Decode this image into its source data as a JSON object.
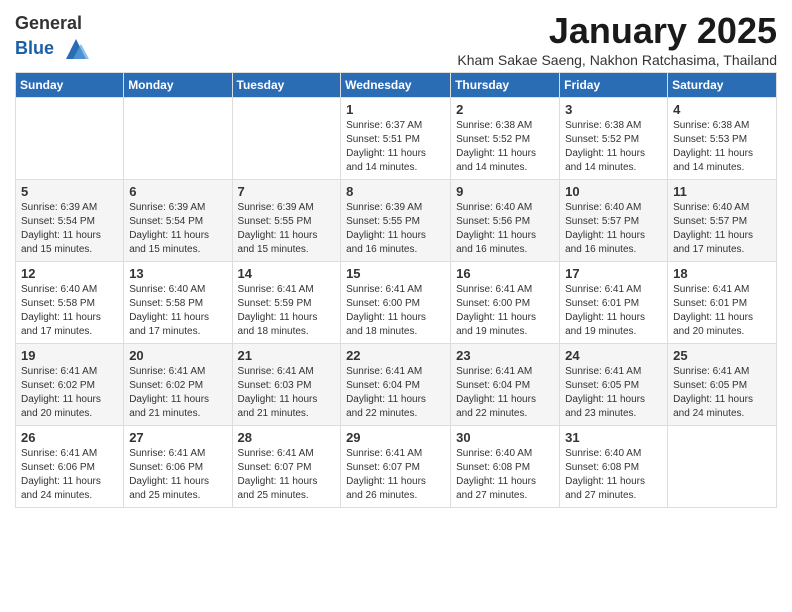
{
  "header": {
    "logo_line1": "General",
    "logo_line2": "Blue",
    "month": "January 2025",
    "location": "Kham Sakae Saeng, Nakhon Ratchasima, Thailand"
  },
  "weekdays": [
    "Sunday",
    "Monday",
    "Tuesday",
    "Wednesday",
    "Thursday",
    "Friday",
    "Saturday"
  ],
  "weeks": [
    [
      {
        "day": "",
        "info": ""
      },
      {
        "day": "",
        "info": ""
      },
      {
        "day": "",
        "info": ""
      },
      {
        "day": "1",
        "info": "Sunrise: 6:37 AM\nSunset: 5:51 PM\nDaylight: 11 hours and 14 minutes."
      },
      {
        "day": "2",
        "info": "Sunrise: 6:38 AM\nSunset: 5:52 PM\nDaylight: 11 hours and 14 minutes."
      },
      {
        "day": "3",
        "info": "Sunrise: 6:38 AM\nSunset: 5:52 PM\nDaylight: 11 hours and 14 minutes."
      },
      {
        "day": "4",
        "info": "Sunrise: 6:38 AM\nSunset: 5:53 PM\nDaylight: 11 hours and 14 minutes."
      }
    ],
    [
      {
        "day": "5",
        "info": "Sunrise: 6:39 AM\nSunset: 5:54 PM\nDaylight: 11 hours and 15 minutes."
      },
      {
        "day": "6",
        "info": "Sunrise: 6:39 AM\nSunset: 5:54 PM\nDaylight: 11 hours and 15 minutes."
      },
      {
        "day": "7",
        "info": "Sunrise: 6:39 AM\nSunset: 5:55 PM\nDaylight: 11 hours and 15 minutes."
      },
      {
        "day": "8",
        "info": "Sunrise: 6:39 AM\nSunset: 5:55 PM\nDaylight: 11 hours and 16 minutes."
      },
      {
        "day": "9",
        "info": "Sunrise: 6:40 AM\nSunset: 5:56 PM\nDaylight: 11 hours and 16 minutes."
      },
      {
        "day": "10",
        "info": "Sunrise: 6:40 AM\nSunset: 5:57 PM\nDaylight: 11 hours and 16 minutes."
      },
      {
        "day": "11",
        "info": "Sunrise: 6:40 AM\nSunset: 5:57 PM\nDaylight: 11 hours and 17 minutes."
      }
    ],
    [
      {
        "day": "12",
        "info": "Sunrise: 6:40 AM\nSunset: 5:58 PM\nDaylight: 11 hours and 17 minutes."
      },
      {
        "day": "13",
        "info": "Sunrise: 6:40 AM\nSunset: 5:58 PM\nDaylight: 11 hours and 17 minutes."
      },
      {
        "day": "14",
        "info": "Sunrise: 6:41 AM\nSunset: 5:59 PM\nDaylight: 11 hours and 18 minutes."
      },
      {
        "day": "15",
        "info": "Sunrise: 6:41 AM\nSunset: 6:00 PM\nDaylight: 11 hours and 18 minutes."
      },
      {
        "day": "16",
        "info": "Sunrise: 6:41 AM\nSunset: 6:00 PM\nDaylight: 11 hours and 19 minutes."
      },
      {
        "day": "17",
        "info": "Sunrise: 6:41 AM\nSunset: 6:01 PM\nDaylight: 11 hours and 19 minutes."
      },
      {
        "day": "18",
        "info": "Sunrise: 6:41 AM\nSunset: 6:01 PM\nDaylight: 11 hours and 20 minutes."
      }
    ],
    [
      {
        "day": "19",
        "info": "Sunrise: 6:41 AM\nSunset: 6:02 PM\nDaylight: 11 hours and 20 minutes."
      },
      {
        "day": "20",
        "info": "Sunrise: 6:41 AM\nSunset: 6:02 PM\nDaylight: 11 hours and 21 minutes."
      },
      {
        "day": "21",
        "info": "Sunrise: 6:41 AM\nSunset: 6:03 PM\nDaylight: 11 hours and 21 minutes."
      },
      {
        "day": "22",
        "info": "Sunrise: 6:41 AM\nSunset: 6:04 PM\nDaylight: 11 hours and 22 minutes."
      },
      {
        "day": "23",
        "info": "Sunrise: 6:41 AM\nSunset: 6:04 PM\nDaylight: 11 hours and 22 minutes."
      },
      {
        "day": "24",
        "info": "Sunrise: 6:41 AM\nSunset: 6:05 PM\nDaylight: 11 hours and 23 minutes."
      },
      {
        "day": "25",
        "info": "Sunrise: 6:41 AM\nSunset: 6:05 PM\nDaylight: 11 hours and 24 minutes."
      }
    ],
    [
      {
        "day": "26",
        "info": "Sunrise: 6:41 AM\nSunset: 6:06 PM\nDaylight: 11 hours and 24 minutes."
      },
      {
        "day": "27",
        "info": "Sunrise: 6:41 AM\nSunset: 6:06 PM\nDaylight: 11 hours and 25 minutes."
      },
      {
        "day": "28",
        "info": "Sunrise: 6:41 AM\nSunset: 6:07 PM\nDaylight: 11 hours and 25 minutes."
      },
      {
        "day": "29",
        "info": "Sunrise: 6:41 AM\nSunset: 6:07 PM\nDaylight: 11 hours and 26 minutes."
      },
      {
        "day": "30",
        "info": "Sunrise: 6:40 AM\nSunset: 6:08 PM\nDaylight: 11 hours and 27 minutes."
      },
      {
        "day": "31",
        "info": "Sunrise: 6:40 AM\nSunset: 6:08 PM\nDaylight: 11 hours and 27 minutes."
      },
      {
        "day": "",
        "info": ""
      }
    ]
  ]
}
